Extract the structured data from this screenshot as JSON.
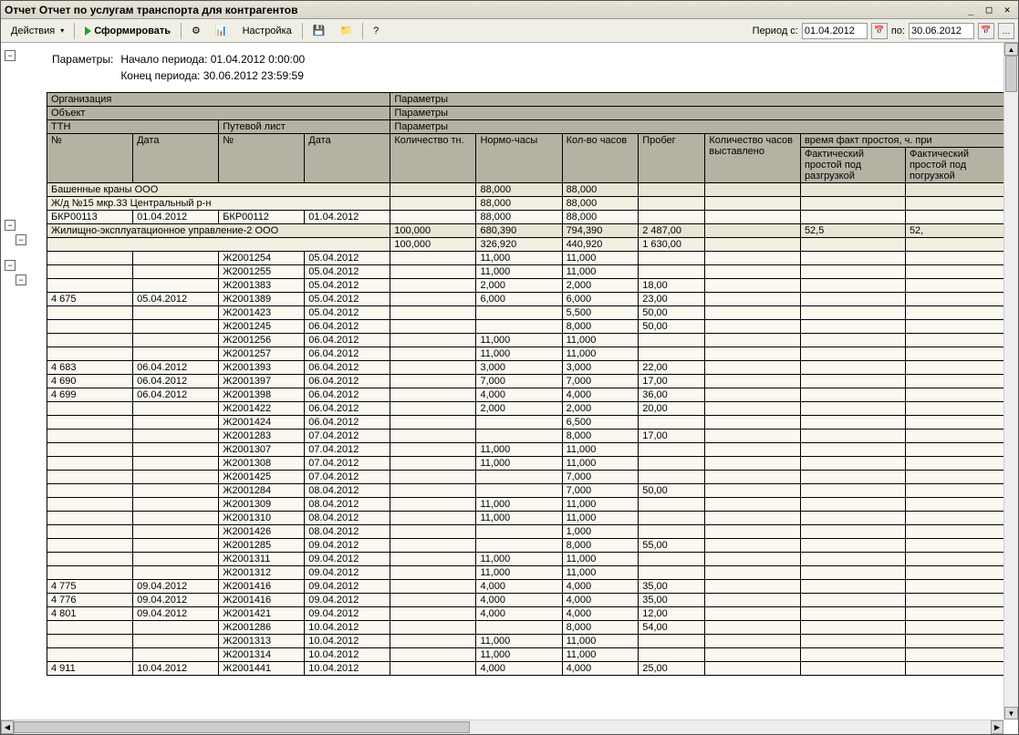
{
  "window": {
    "title": "Отчет  Отчет по услугам транспорта для контрагентов"
  },
  "toolbar": {
    "actions": "Действия",
    "form": "Сформировать",
    "settings": "Настройка",
    "period_label1": "Период с:",
    "period_from": "01.04.2012",
    "period_label2": "по:",
    "period_to": "30.06.2012"
  },
  "params": {
    "label": "Параметры:",
    "start": "Начало периода: 01.04.2012 0:00:00",
    "end": "Конец периода: 30.06.2012 23:59:59"
  },
  "headers": {
    "org": "Организация",
    "param": "Параметры",
    "obj": "Объект",
    "ttn": "ТТН",
    "waybill": "Путевой лист",
    "no": "№",
    "date": "Дата",
    "qty": "Количество тн.",
    "normh": "Нормо-часы",
    "hours": "Кол-во часов",
    "mileage": "Пробег",
    "hours_billed": "Количество часов выставлено",
    "idle_group": "время факт простоя, ч. при",
    "idle_unload": "Фактический простой под разгрузкой",
    "idle_load": "Фактический простой под погрузкой"
  },
  "groups": [
    {
      "cls": "grp1",
      "span": 4,
      "text": "Башенные краны ООО",
      "v": [
        "",
        "88,000",
        "88,000",
        "",
        "",
        "",
        ""
      ]
    },
    {
      "cls": "grp2",
      "span": 4,
      "text": "Ж/д №15 мкр.33 Центральный р-н",
      "v": [
        "",
        "88,000",
        "88,000",
        "",
        "",
        "",
        ""
      ]
    },
    {
      "cls": "grp3",
      "row": [
        "БКР00113",
        "01.04.2012",
        "БКР00112",
        "01.04.2012"
      ],
      "v": [
        "",
        "88,000",
        "88,000",
        "",
        "",
        "",
        ""
      ]
    },
    {
      "cls": "grp1",
      "span": 4,
      "text": "Жилищно-эксплуатационное управление-2 ООО",
      "v": [
        "100,000",
        "680,390",
        "794,390",
        "2 487,00",
        "",
        "52,5",
        "52,"
      ]
    },
    {
      "cls": "grp2",
      "span": 4,
      "text": "",
      "v": [
        "100,000",
        "326,920",
        "440,920",
        "1 630,00",
        "",
        "",
        ""
      ]
    }
  ],
  "rows": [
    {
      "r": [
        "",
        "",
        "Ж2001254",
        "05.04.2012"
      ],
      "v": [
        "",
        "11,000",
        "11,000",
        "",
        "",
        "",
        ""
      ]
    },
    {
      "r": [
        "",
        "",
        "Ж2001255",
        "05.04.2012"
      ],
      "v": [
        "",
        "11,000",
        "11,000",
        "",
        "",
        "",
        ""
      ]
    },
    {
      "r": [
        "",
        "",
        "Ж2001383",
        "05.04.2012"
      ],
      "v": [
        "",
        "2,000",
        "2,000",
        "18,00",
        "",
        "",
        ""
      ]
    },
    {
      "r": [
        "4 675",
        "05.04.2012",
        "Ж2001389",
        "05.04.2012"
      ],
      "v": [
        "",
        "6,000",
        "6,000",
        "23,00",
        "",
        "",
        ""
      ]
    },
    {
      "r": [
        "",
        "",
        "Ж2001423",
        "05.04.2012"
      ],
      "v": [
        "",
        "",
        "5,500",
        "50,00",
        "",
        "",
        ""
      ]
    },
    {
      "r": [
        "",
        "",
        "Ж2001245",
        "06.04.2012"
      ],
      "v": [
        "",
        "",
        "8,000",
        "50,00",
        "",
        "",
        ""
      ]
    },
    {
      "r": [
        "",
        "",
        "Ж2001256",
        "06.04.2012"
      ],
      "v": [
        "",
        "11,000",
        "11,000",
        "",
        "",
        "",
        ""
      ]
    },
    {
      "r": [
        "",
        "",
        "Ж2001257",
        "06.04.2012"
      ],
      "v": [
        "",
        "11,000",
        "11,000",
        "",
        "",
        "",
        ""
      ]
    },
    {
      "r": [
        "4 683",
        "06.04.2012",
        "Ж2001393",
        "06.04.2012"
      ],
      "v": [
        "",
        "3,000",
        "3,000",
        "22,00",
        "",
        "",
        ""
      ]
    },
    {
      "r": [
        "4 690",
        "06.04.2012",
        "Ж2001397",
        "06.04.2012"
      ],
      "v": [
        "",
        "7,000",
        "7,000",
        "17,00",
        "",
        "",
        ""
      ]
    },
    {
      "r": [
        "4 699",
        "06.04.2012",
        "Ж2001398",
        "06.04.2012"
      ],
      "v": [
        "",
        "4,000",
        "4,000",
        "36,00",
        "",
        "",
        ""
      ]
    },
    {
      "r": [
        "",
        "",
        "Ж2001422",
        "06.04.2012"
      ],
      "v": [
        "",
        "2,000",
        "2,000",
        "20,00",
        "",
        "",
        ""
      ]
    },
    {
      "r": [
        "",
        "",
        "Ж2001424",
        "06.04.2012"
      ],
      "v": [
        "",
        "",
        "6,500",
        "",
        "",
        "",
        ""
      ]
    },
    {
      "r": [
        "",
        "",
        "Ж2001283",
        "07.04.2012"
      ],
      "v": [
        "",
        "",
        "8,000",
        "17,00",
        "",
        "",
        ""
      ]
    },
    {
      "r": [
        "",
        "",
        "Ж2001307",
        "07.04.2012"
      ],
      "v": [
        "",
        "11,000",
        "11,000",
        "",
        "",
        "",
        ""
      ]
    },
    {
      "r": [
        "",
        "",
        "Ж2001308",
        "07.04.2012"
      ],
      "v": [
        "",
        "11,000",
        "11,000",
        "",
        "",
        "",
        ""
      ]
    },
    {
      "r": [
        "",
        "",
        "Ж2001425",
        "07.04.2012"
      ],
      "v": [
        "",
        "",
        "7,000",
        "",
        "",
        "",
        ""
      ]
    },
    {
      "r": [
        "",
        "",
        "Ж2001284",
        "08.04.2012"
      ],
      "v": [
        "",
        "",
        "7,000",
        "50,00",
        "",
        "",
        ""
      ]
    },
    {
      "r": [
        "",
        "",
        "Ж2001309",
        "08.04.2012"
      ],
      "v": [
        "",
        "11,000",
        "11,000",
        "",
        "",
        "",
        ""
      ]
    },
    {
      "r": [
        "",
        "",
        "Ж2001310",
        "08.04.2012"
      ],
      "v": [
        "",
        "11,000",
        "11,000",
        "",
        "",
        "",
        ""
      ]
    },
    {
      "r": [
        "",
        "",
        "Ж2001426",
        "08.04.2012"
      ],
      "v": [
        "",
        "",
        "1,000",
        "",
        "",
        "",
        ""
      ]
    },
    {
      "r": [
        "",
        "",
        "Ж2001285",
        "09.04.2012"
      ],
      "v": [
        "",
        "",
        "8,000",
        "55,00",
        "",
        "",
        ""
      ]
    },
    {
      "r": [
        "",
        "",
        "Ж2001311",
        "09.04.2012"
      ],
      "v": [
        "",
        "11,000",
        "11,000",
        "",
        "",
        "",
        ""
      ]
    },
    {
      "r": [
        "",
        "",
        "Ж2001312",
        "09.04.2012"
      ],
      "v": [
        "",
        "11,000",
        "11,000",
        "",
        "",
        "",
        ""
      ]
    },
    {
      "r": [
        "4 775",
        "09.04.2012",
        "Ж2001416",
        "09.04.2012"
      ],
      "v": [
        "",
        "4,000",
        "4,000",
        "35,00",
        "",
        "",
        ""
      ]
    },
    {
      "r": [
        "4 776",
        "09.04.2012",
        "Ж2001416",
        "09.04.2012"
      ],
      "v": [
        "",
        "4,000",
        "4,000",
        "35,00",
        "",
        "",
        ""
      ]
    },
    {
      "r": [
        "4 801",
        "09.04.2012",
        "Ж2001421",
        "09.04.2012"
      ],
      "v": [
        "",
        "4,000",
        "4,000",
        "12,00",
        "",
        "",
        ""
      ]
    },
    {
      "r": [
        "",
        "",
        "Ж2001286",
        "10.04.2012"
      ],
      "v": [
        "",
        "",
        "8,000",
        "54,00",
        "",
        "",
        ""
      ]
    },
    {
      "r": [
        "",
        "",
        "Ж2001313",
        "10.04.2012"
      ],
      "v": [
        "",
        "11,000",
        "11,000",
        "",
        "",
        "",
        ""
      ]
    },
    {
      "r": [
        "",
        "",
        "Ж2001314",
        "10.04.2012"
      ],
      "v": [
        "",
        "11,000",
        "11,000",
        "",
        "",
        "",
        ""
      ]
    },
    {
      "r": [
        "4 911",
        "10.04.2012",
        "Ж2001441",
        "10.04.2012"
      ],
      "v": [
        "",
        "4,000",
        "4,000",
        "25,00",
        "",
        "",
        ""
      ]
    }
  ]
}
